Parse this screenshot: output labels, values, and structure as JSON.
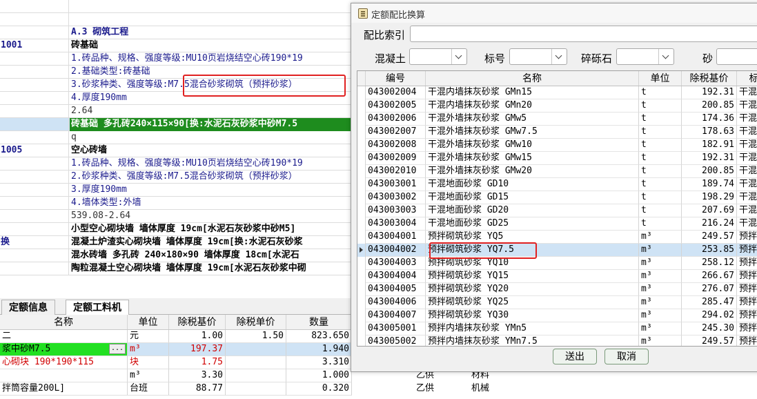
{
  "background": {
    "rows": [
      {
        "code": "",
        "text": ""
      },
      {
        "code": "",
        "text": ""
      },
      {
        "code": "",
        "text": "A.3 砌筑工程"
      },
      {
        "code": "1001",
        "text": "砖基础"
      },
      {
        "code": "",
        "text": "1.砖品种、规格、强度等级:MU10页岩烧结空心砖190*19"
      },
      {
        "code": "",
        "text": "2.基础类型:砖基础"
      },
      {
        "code": "",
        "text": "3.砂浆种类、强度等级:M7.5混合砂浆砌筑（预拌砂浆）"
      },
      {
        "code": "",
        "text": "4.厚度190mm"
      },
      {
        "code": "",
        "text": "2.64"
      },
      {
        "code": "",
        "text": "砖基础 多孔砖240×115×90[换:水泥石灰砂浆中砂M7.5"
      },
      {
        "code": "",
        "text": "q"
      },
      {
        "code": "1005",
        "text": "空心砖墙"
      },
      {
        "code": "",
        "text": "1.砖品种、规格、强度等级:MU10页岩烧结空心砖190*19"
      },
      {
        "code": "",
        "text": "2.砂浆种类、强度等级:M7.5混合砂浆砌筑（预拌砂浆）"
      },
      {
        "code": "",
        "text": "3.厚度190mm"
      },
      {
        "code": "",
        "text": "4.墙体类型:外墙"
      },
      {
        "code": "",
        "text": "539.08-2.64"
      },
      {
        "code": "",
        "text": "小型空心砌块墙 墙体厚度 19cm[水泥石灰砂浆中砂M5]"
      },
      {
        "code": "换",
        "text": "混凝土炉渣实心砌块墙 墙体厚度 19cm[换:水泥石灰砂浆"
      },
      {
        "code": "",
        "text": "混水砖墙 多孔砖 240×180×90 墙体厚度 18cm[水泥石"
      },
      {
        "code": "",
        "text": "陶粒混凝土空心砌块墙 墙体厚度 19cm[水泥石灰砂浆中砌"
      }
    ]
  },
  "tabs": [
    "定额信息",
    "定额工料机"
  ],
  "bottom_grid": {
    "headers": [
      "名称",
      "单位",
      "除税基价",
      "除税单价",
      "数量"
    ],
    "rows": [
      {
        "name": "二",
        "unit": "元",
        "base": "1.00",
        "price": "1.50",
        "qty": "823.650",
        "extra1": "",
        "extra2": ""
      },
      {
        "name": "浆中砂M7.5",
        "unit": "m³",
        "base": "197.37",
        "price": "",
        "qty": "1.940",
        "extra1": "",
        "extra2": ""
      },
      {
        "name": "心砌块 190*190*115",
        "unit": "块",
        "base": "1.75",
        "price": "",
        "qty": "3.310",
        "extra1": "",
        "extra2": ""
      },
      {
        "name": "",
        "unit": "m³",
        "base": "3.30",
        "price": "",
        "qty": "1.000",
        "extra1": "乙供",
        "extra2": "材料"
      },
      {
        "name": "拌筒容量200L]",
        "unit": "台班",
        "base": "88.77",
        "price": "",
        "qty": "0.320",
        "extra1": "乙供",
        "extra2": "机械"
      }
    ],
    "ellipsis": "..."
  },
  "dialog": {
    "title": "定额配比换算",
    "index_label": "配比索引",
    "index_value": "",
    "concrete_label": "混凝土",
    "concrete_value": "",
    "grade_label": "标号",
    "grade_value": "",
    "gravel_label": "碎砾石",
    "gravel_value": "",
    "sand_label": "砂",
    "sand_value": "",
    "grid_headers": [
      "编号",
      "名称",
      "单位",
      "除税基价",
      "标"
    ],
    "rows": [
      {
        "code": "043002004",
        "name": "干混内墙抹灰砂浆 GMn15",
        "unit": "t",
        "price": "192.31",
        "tag": "干混"
      },
      {
        "code": "043002005",
        "name": "干混内墙抹灰砂浆 GMn20",
        "unit": "t",
        "price": "200.85",
        "tag": "干混"
      },
      {
        "code": "043002006",
        "name": "干混外墙抹灰砂浆 GMw5",
        "unit": "t",
        "price": "174.36",
        "tag": "干混"
      },
      {
        "code": "043002007",
        "name": "干混外墙抹灰砂浆 GMw7.5",
        "unit": "t",
        "price": "178.63",
        "tag": "干混"
      },
      {
        "code": "043002008",
        "name": "干混外墙抹灰砂浆 GMw10",
        "unit": "t",
        "price": "182.91",
        "tag": "干混"
      },
      {
        "code": "043002009",
        "name": "干混外墙抹灰砂浆 GMw15",
        "unit": "t",
        "price": "192.31",
        "tag": "干混"
      },
      {
        "code": "043002010",
        "name": "干混外墙抹灰砂浆 GMw20",
        "unit": "t",
        "price": "200.85",
        "tag": "干混"
      },
      {
        "code": "043003001",
        "name": "干混地面砂浆 GD10",
        "unit": "t",
        "price": "189.74",
        "tag": "干混"
      },
      {
        "code": "043003002",
        "name": "干混地面砂浆 GD15",
        "unit": "t",
        "price": "198.29",
        "tag": "干混"
      },
      {
        "code": "043003003",
        "name": "干混地面砂浆 GD20",
        "unit": "t",
        "price": "207.69",
        "tag": "干混"
      },
      {
        "code": "043003004",
        "name": "干混地面砂浆 GD25",
        "unit": "t",
        "price": "216.24",
        "tag": "干混"
      },
      {
        "code": "043004001",
        "name": "预拌砌筑砂浆 YQ5",
        "unit": "m³",
        "price": "249.57",
        "tag": "预拌"
      },
      {
        "code": "043004002",
        "name": "预拌砌筑砂浆 YQ7.5",
        "unit": "m³",
        "price": "253.85",
        "tag": "预拌"
      },
      {
        "code": "043004003",
        "name": "预拌砌筑砂浆 YQ10",
        "unit": "m³",
        "price": "258.12",
        "tag": "预拌"
      },
      {
        "code": "043004004",
        "name": "预拌砌筑砂浆 YQ15",
        "unit": "m³",
        "price": "266.67",
        "tag": "预拌"
      },
      {
        "code": "043004005",
        "name": "预拌砌筑砂浆 YQ20",
        "unit": "m³",
        "price": "276.07",
        "tag": "预拌"
      },
      {
        "code": "043004006",
        "name": "预拌砌筑砂浆 YQ25",
        "unit": "m³",
        "price": "285.47",
        "tag": "预拌"
      },
      {
        "code": "043004007",
        "name": "预拌砌筑砂浆 YQ30",
        "unit": "m³",
        "price": "294.02",
        "tag": "预拌"
      },
      {
        "code": "043005001",
        "name": "预拌内墙抹灰砂浆 YMn5",
        "unit": "m³",
        "price": "245.30",
        "tag": "预拌"
      },
      {
        "code": "043005002",
        "name": "预拌内墙抹灰砂浆 YMn7.5",
        "unit": "m³",
        "price": "249.57",
        "tag": "预拌"
      }
    ],
    "selected_row": 12,
    "ok_label": "送出",
    "cancel_label": "取消"
  },
  "colors": {
    "highlight": "#e02020",
    "selection": "#cfe3f5",
    "green_row": "#1e8c1e",
    "green_cell": "#22e022",
    "heading_blue": "#1a1a8c"
  }
}
